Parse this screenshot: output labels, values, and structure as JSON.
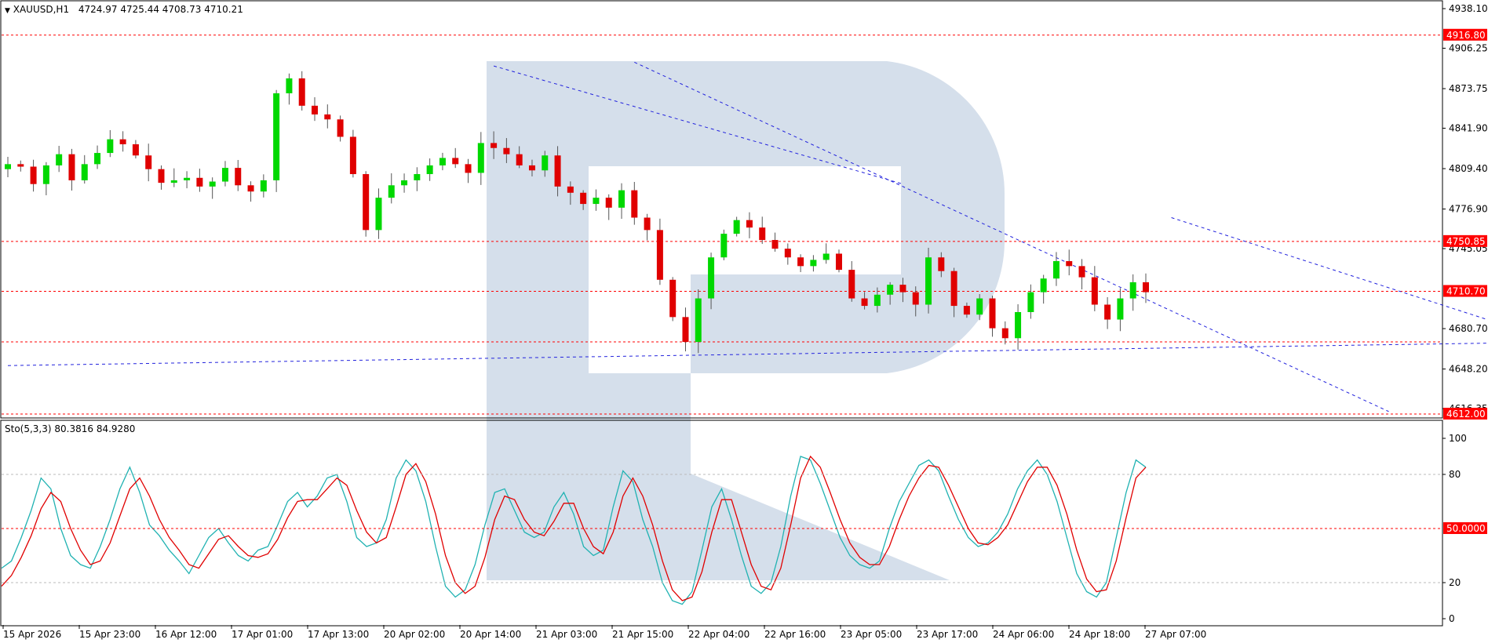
{
  "header": {
    "symbol": "XAUUSD,H1",
    "ohlc": "4724.97 4725.44 4708.73 4710.21"
  },
  "indicator": {
    "label": "Sto(5,3,3) 80.3816 84.9280"
  },
  "colors": {
    "bull": "#00d800",
    "bear": "#e00000",
    "level_line": "#ff0000",
    "tag_bg": "#ff0000",
    "forecast": "#2222dd",
    "stoch_main": "#20b2b2",
    "stoch_signal": "#e00000",
    "watermark": "#d5dfeb"
  },
  "chart_data": [
    {
      "type": "candlestick",
      "ylim": [
        4612,
        4940
      ],
      "y_ticks": [
        "4938.10",
        "4906.25",
        "4873.75",
        "4841.90",
        "4809.40",
        "4776.90",
        "4745.05",
        "4680.70",
        "4648.20",
        "4616.35"
      ],
      "x_ticks": [
        "15 Apr 2026",
        "15 Apr 23:00",
        "16 Apr 12:00",
        "17 Apr 01:00",
        "17 Apr 13:00",
        "20 Apr 02:00",
        "20 Apr 14:00",
        "21 Apr 03:00",
        "21 Apr 15:00",
        "22 Apr 04:00",
        "22 Apr 16:00",
        "23 Apr 05:00",
        "23 Apr 17:00",
        "24 Apr 06:00",
        "24 Apr 18:00",
        "27 Apr 07:00"
      ],
      "levels": [
        {
          "value": 4916.8,
          "label": "4916.80"
        },
        {
          "value": 4750.85,
          "label": "4750.85"
        },
        {
          "value": 4710.7,
          "label": "4710.70"
        },
        {
          "value": 4612.0,
          "label": "4612.00"
        },
        {
          "value": 4670.0,
          "label": ""
        }
      ],
      "key_closes": [
        4813,
        4811,
        4797,
        4812,
        4821,
        4800,
        4813,
        4822,
        4833,
        4829,
        4820,
        4809,
        4798,
        4800,
        4802,
        4795,
        4799,
        4810,
        4796,
        4791,
        4800,
        4870,
        4882,
        4860,
        4853,
        4849,
        4835,
        4805,
        4760,
        4786,
        4796,
        4800,
        4805,
        4812,
        4818,
        4813,
        4806,
        4830,
        4826,
        4821,
        4812,
        4808,
        4820,
        4795,
        4790,
        4781,
        4786,
        4778,
        4792,
        4770,
        4760,
        4720,
        4690,
        4670,
        4705,
        4738,
        4757,
        4768,
        4762,
        4752,
        4745,
        4738,
        4731,
        4736,
        4741,
        4728,
        4705,
        4699,
        4708,
        4716,
        4710,
        4700,
        4738,
        4727,
        4699,
        4692,
        4705,
        4681,
        4673,
        4694,
        4710,
        4721,
        4735,
        4731,
        4722,
        4700,
        4688,
        4705,
        4718,
        4710
      ],
      "forecast_path": [
        {
          "x": 0,
          "y": 4651
        },
        {
          "x": 135,
          "y": 4672
        },
        {
          "x": 154,
          "y": 4752
        },
        {
          "x": 158,
          "y": 4614
        },
        {
          "x": 162,
          "y": 4752
        },
        {
          "x": 182,
          "y": 4614
        }
      ]
    },
    {
      "type": "line",
      "ylim": [
        0,
        100
      ],
      "y_ticks": [
        "100",
        "80",
        "20",
        "0"
      ],
      "levels": [
        {
          "value": 50,
          "label": "50.0000"
        },
        {
          "value": 80,
          "label": ""
        },
        {
          "value": 20,
          "label": ""
        }
      ],
      "series": [
        {
          "name": "Sto(5,3,3) main",
          "values": [
            28,
            32,
            45,
            60,
            78,
            72,
            50,
            35,
            30,
            28,
            40,
            55,
            72,
            84,
            70,
            52,
            46,
            38,
            32,
            25,
            35,
            45,
            50,
            42,
            35,
            32,
            38,
            40,
            52,
            65,
            70,
            62,
            68,
            78,
            80,
            65,
            45,
            40,
            42,
            55,
            78,
            88,
            82,
            65,
            40,
            18,
            12,
            16,
            30,
            52,
            70,
            72,
            60,
            48,
            45,
            48,
            62,
            70,
            58,
            40,
            35,
            38,
            62,
            82,
            76,
            55,
            40,
            20,
            10,
            8,
            15,
            38,
            62,
            72,
            55,
            35,
            18,
            14,
            20,
            40,
            68,
            90,
            88,
            75,
            60,
            45,
            35,
            30,
            28,
            32,
            50,
            65,
            75,
            85,
            88,
            82,
            68,
            55,
            45,
            40,
            42,
            48,
            58,
            72,
            82,
            88,
            80,
            65,
            45,
            25,
            15,
            12,
            20,
            45,
            70,
            88,
            84
          ]
        },
        {
          "name": "Sto(5,3,3) signal",
          "values": [
            18,
            24,
            34,
            46,
            61,
            70,
            65,
            50,
            38,
            30,
            32,
            42,
            57,
            72,
            78,
            68,
            55,
            45,
            38,
            30,
            28,
            36,
            44,
            46,
            40,
            35,
            34,
            36,
            44,
            56,
            65,
            66,
            66,
            72,
            78,
            74,
            60,
            48,
            42,
            45,
            62,
            80,
            86,
            76,
            58,
            35,
            20,
            14,
            18,
            34,
            55,
            68,
            66,
            55,
            48,
            46,
            54,
            64,
            64,
            50,
            40,
            36,
            48,
            68,
            78,
            68,
            52,
            32,
            16,
            10,
            12,
            26,
            48,
            66,
            66,
            48,
            30,
            18,
            16,
            28,
            52,
            78,
            90,
            84,
            70,
            55,
            42,
            34,
            30,
            30,
            40,
            55,
            68,
            78,
            85,
            84,
            74,
            62,
            50,
            42,
            41,
            45,
            52,
            64,
            76,
            84,
            84,
            74,
            58,
            38,
            22,
            15,
            16,
            32,
            56,
            78,
            84
          ]
        }
      ]
    }
  ]
}
